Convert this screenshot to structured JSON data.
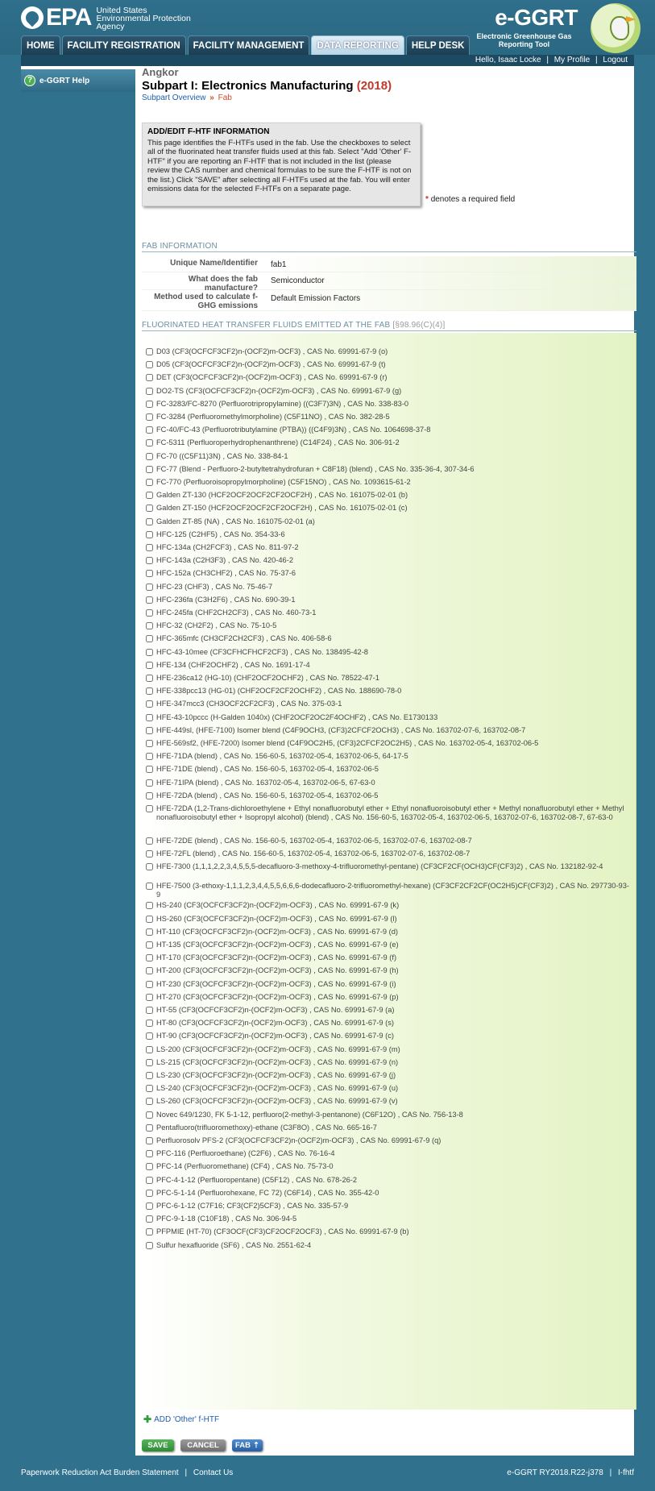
{
  "header": {
    "agency_line1": "United States",
    "agency_line2": "Environmental Protection",
    "agency_line3": "Agency",
    "epa_logo_text": "EPA",
    "app_logo_title": "e-GGRT",
    "app_logo_subtitle": "Electronic Greenhouse Gas Reporting Tool",
    "nav_tabs": [
      "HOME",
      "FACILITY REGISTRATION",
      "FACILITY MANAGEMENT",
      "DATA REPORTING",
      "HELP DESK"
    ],
    "active_tab": "DATA REPORTING"
  },
  "userbar": {
    "greeting": "Hello, Isaac Locke",
    "my_profile": "My Profile",
    "logout": "Logout"
  },
  "sidebar": {
    "help_label": "e-GGRT Help",
    "help_icon": "question-icon"
  },
  "main": {
    "facility": "Angkor",
    "title": "Subpart I: Electronics Manufacturing",
    "year": "(2018)",
    "breadcrumb": {
      "link": "Subpart Overview",
      "separator": "»",
      "current": "Fab"
    },
    "info": {
      "title": "ADD/EDIT F-HTF INFORMATION",
      "body": "This page identifies the F-HTFs used in the fab. Use the checkboxes to select all of the fluorinated heat transfer fluids used at this fab. Select \"Add 'Other' F-HTF\" if you are reporting an F-HTF that is not included in the list (please review the CAS number and chemical formulas to be sure the F-HTF is not on the list.) Click \"SAVE\" after selecting all F-HTFs used at the fab. You will enter emissions data for the selected F-HTFs on a separate page."
    },
    "required_note": "denotes a required field",
    "required_star": "*",
    "fab_section_title": "FAB INFORMATION",
    "fab_rows": [
      {
        "label": "Unique Name/Identifier",
        "value": "fab1"
      },
      {
        "label": "What does the fab manufacture?",
        "value": "Semiconductor"
      },
      {
        "label": "Method used to calculate f-GHG emissions",
        "value": "Default Emission Factors"
      }
    ],
    "fluids_section_title": "FLUORINATED HEAT TRANSFER FLUIDS EMITTED AT THE FAB",
    "fluids_section_cite": "[§98.96(C)(4)]",
    "fluids": [
      "D03 (CF3(OCFCF3CF2)n-(OCF2)m-OCF3) , CAS No. 69991-67-9 (o)",
      "D05 (CF3(OCFCF3CF2)n-(OCF2)m-OCF3) , CAS No. 69991-67-9 (t)",
      "DET (CF3(OCFCF3CF2)n-(OCF2)m-OCF3) , CAS No. 69991-67-9 (r)",
      "DO2-TS (CF3(OCFCF3CF2)n-(OCF2)m-OCF3) , CAS No. 69991-67-9 (g)",
      "FC-3283/FC-8270 (Perfluorotripropylamine) ((C3F7)3N) , CAS No. 338-83-0",
      "FC-3284 (Perfluoromethylmorpholine) (C5F11NO) , CAS No. 382-28-5",
      "FC-40/FC-43 (Perfluorotributylamine (PTBA)) ((C4F9)3N) , CAS No. 1064698-37-8",
      "FC-5311 (Perfluoroperhydrophenanthrene) (C14F24) , CAS No. 306-91-2",
      "FC-70 ((C5F11)3N) , CAS No. 338-84-1",
      "FC-77 (Blend - Perfluoro-2-butyltetrahydrofuran + C8F18) (blend) , CAS No. 335-36-4, 307-34-6",
      "FC-770 (Perfluoroisopropylmorpholine) (C5F15NO) , CAS No. 1093615-61-2",
      "Galden ZT-130 (HCF2OCF2OCF2CF2OCF2H) , CAS No. 161075-02-01 (b)",
      "Galden ZT-150 (HCF2OCF2OCF2CF2OCF2H) , CAS No. 161075-02-01 (c)",
      "Galden ZT-85 (NA) , CAS No. 161075-02-01 (a)",
      "HFC-125 (C2HF5) , CAS No. 354-33-6",
      "HFC-134a (CH2FCF3) , CAS No. 811-97-2",
      "HFC-143a (C2H3F3) , CAS No. 420-46-2",
      "HFC-152a (CH3CHF2) , CAS No. 75-37-6",
      "HFC-23 (CHF3) , CAS No. 75-46-7",
      "HFC-236fa (C3H2F6) , CAS No. 690-39-1",
      "HFC-245fa (CHF2CH2CF3) , CAS No. 460-73-1",
      "HFC-32 (CH2F2) , CAS No. 75-10-5",
      "HFC-365mfc (CH3CF2CH2CF3) , CAS No. 406-58-6",
      "HFC-43-10mee (CF3CFHCFHCF2CF3) , CAS No. 138495-42-8",
      "HFE-134 (CHF2OCHF2) , CAS No. 1691-17-4",
      "HFE-236ca12 (HG-10) (CHF2OCF2OCHF2) , CAS No. 78522-47-1",
      "HFE-338pcc13 (HG-01) (CHF2OCF2CF2OCHF2) , CAS No. 188690-78-0",
      "HFE-347mcc3 (CH3OCF2CF2CF3) , CAS No. 375-03-1",
      "HFE-43-10pccc (H-Galden 1040x) (CHF2OCF2OC2F4OCHF2) , CAS No. E1730133",
      "HFE-449sl, (HFE-7100) Isomer blend (C4F9OCH3, (CF3)2CFCF2OCH3) , CAS No. 163702-07-6, 163702-08-7",
      "HFE-569sf2, (HFE-7200) Isomer blend (C4F9OC2H5, (CF3)2CFCF2OC2H5) , CAS No. 163702-05-4, 163702-06-5",
      "HFE-71DA (blend) , CAS No. 156-60-5, 163702-05-4, 163702-06-5, 64-17-5",
      "HFE-71DE (blend) , CAS No. 156-60-5, 163702-05-4, 163702-06-5",
      "HFE-71IPA (blend) , CAS No. 163702-05-4, 163702-06-5, 67-63-0",
      "HFE-72DA (blend) , CAS No. 156-60-5, 163702-05-4, 163702-06-5",
      "HFE-72DA (1,2-Trans-dichloroethylene + Ethyl nonafluorobutyl ether + Ethyl nonafluoroisobutyl ether + Methyl nonafluorobutyl ether + Methyl nonafluoroisobutyl ether + Isopropyl alcohol) (blend) , CAS No. 156-60-5, 163702-05-4, 163702-06-5, 163702-07-6, 163702-08-7, 67-63-0",
      "HFE-72DE (blend) , CAS No. 156-60-5, 163702-05-4, 163702-06-5, 163702-07-6, 163702-08-7",
      "HFE-72FL (blend) , CAS No. 156-60-5, 163702-05-4, 163702-06-5, 163702-07-6, 163702-08-7",
      "HFE-7300 (1,1,1,2,2,3,4,5,5,5-decafluoro-3-methoxy-4-trifluoromethyl-pentane) (CF3CF2CF(OCH3)CF(CF3)2) , CAS No. 132182-92-4",
      "HFE-7500 (3-ethoxy-1,1,1,2,3,4,4,5,5,6,6,6-dodecafluoro-2-trifluoromethyl-hexane) (CF3CF2CF2CF(OC2H5)CF(CF3)2) , CAS No. 297730-93-9",
      "HS-240 (CF3(OCFCF3CF2)n-(OCF2)m-OCF3) , CAS No. 69991-67-9 (k)",
      "HS-260 (CF3(OCFCF3CF2)n-(OCF2)m-OCF3) , CAS No. 69991-67-9 (l)",
      "HT-110 (CF3(OCFCF3CF2)n-(OCF2)m-OCF3) , CAS No. 69991-67-9 (d)",
      "HT-135 (CF3(OCFCF3CF2)n-(OCF2)m-OCF3) , CAS No. 69991-67-9 (e)",
      "HT-170 (CF3(OCFCF3CF2)n-(OCF2)m-OCF3) , CAS No. 69991-67-9 (f)",
      "HT-200 (CF3(OCFCF3CF2)n-(OCF2)m-OCF3) , CAS No. 69991-67-9 (h)",
      "HT-230 (CF3(OCFCF3CF2)n-(OCF2)m-OCF3) , CAS No. 69991-67-9 (i)",
      "HT-270 (CF3(OCFCF3CF2)n-(OCF2)m-OCF3) , CAS No. 69991-67-9 (p)",
      "HT-55 (CF3(OCFCF3CF2)n-(OCF2)m-OCF3) , CAS No. 69991-67-9 (a)",
      "HT-80 (CF3(OCFCF3CF2)n-(OCF2)m-OCF3) , CAS No. 69991-67-9 (s)",
      "HT-90 (CF3(OCFCF3CF2)n-(OCF2)m-OCF3) , CAS No. 69991-67-9 (c)",
      "LS-200 (CF3(OCFCF3CF2)n-(OCF2)m-OCF3) , CAS No. 69991-67-9 (m)",
      "LS-215 (CF3(OCFCF3CF2)n-(OCF2)m-OCF3) , CAS No. 69991-67-9 (n)",
      "LS-230 (CF3(OCFCF3CF2)n-(OCF2)m-OCF3) , CAS No. 69991-67-9 (j)",
      "LS-240 (CF3(OCFCF3CF2)n-(OCF2)m-OCF3) , CAS No. 69991-67-9 (u)",
      "LS-260 (CF3(OCFCF3CF2)n-(OCF2)m-OCF3) , CAS No. 69991-67-9 (v)",
      "Novec 649/1230, FK 5-1-12, perfluoro(2-methyl-3-pentanone) (C6F12O) , CAS No. 756-13-8",
      "Pentafluoro(trifluoromethoxy)-ethane (C3F8O) , CAS No. 665-16-7",
      "Perfluorosolv PFS-2 (CF3(OCFCF3CF2)n-(OCF2)m-OCF3) , CAS No. 69991-67-9 (q)",
      "PFC-116 (Perfluoroethane) (C2F6) , CAS No. 76-16-4",
      "PFC-14 (Perfluoromethane) (CF4) , CAS No. 75-73-0",
      "PFC-4-1-12 (Perfluoropentane) (C5F12) , CAS No. 678-26-2",
      "PFC-5-1-14 (Perfluorohexane, FC 72) (C6F14) , CAS No. 355-42-0",
      "PFC-6-1-12 (C7F16; CF3(CF2)5CF3) , CAS No. 335-57-9",
      "PFC-9-1-18 (C10F18) , CAS No. 306-94-5",
      "PFPMIE (HT-70) (CF3OCF(CF3)CF2OCF2OCF3) , CAS No. 69991-67-9 (b)",
      "Sulfur hexafluoride (SF6) , CAS No. 2551-62-4"
    ],
    "add_other_label": "ADD 'Other' f-HTF",
    "buttons": {
      "save": "SAVE",
      "cancel": "CANCEL",
      "fab": "FAB"
    }
  },
  "footer": {
    "paperwork": "Paperwork Reduction Act Burden Statement",
    "contact": "Contact Us",
    "version": "e-GGRT RY2018.R22-j378",
    "code": "I-fhtf"
  }
}
